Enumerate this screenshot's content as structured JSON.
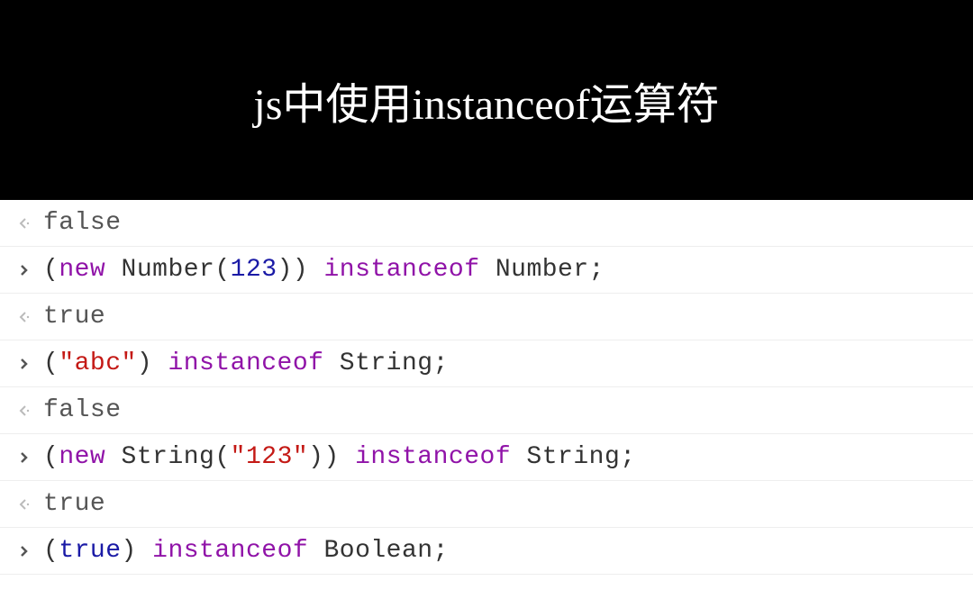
{
  "header": {
    "title": "js中使用instanceof运算符"
  },
  "console": {
    "rows": [
      {
        "type": "output",
        "tokens": [
          {
            "text": "false",
            "cls": "tok-result"
          }
        ]
      },
      {
        "type": "input",
        "tokens": [
          {
            "text": "(",
            "cls": "tok-default"
          },
          {
            "text": "new",
            "cls": "tok-keyword"
          },
          {
            "text": " Number(",
            "cls": "tok-default"
          },
          {
            "text": "123",
            "cls": "tok-number"
          },
          {
            "text": ")) ",
            "cls": "tok-default"
          },
          {
            "text": "instanceof",
            "cls": "tok-keyword"
          },
          {
            "text": " Number;",
            "cls": "tok-default"
          }
        ]
      },
      {
        "type": "output",
        "tokens": [
          {
            "text": "true",
            "cls": "tok-result"
          }
        ]
      },
      {
        "type": "input",
        "tokens": [
          {
            "text": "(",
            "cls": "tok-default"
          },
          {
            "text": "\"abc\"",
            "cls": "tok-string"
          },
          {
            "text": ") ",
            "cls": "tok-default"
          },
          {
            "text": "instanceof",
            "cls": "tok-keyword"
          },
          {
            "text": " String;",
            "cls": "tok-default"
          }
        ]
      },
      {
        "type": "output",
        "tokens": [
          {
            "text": "false",
            "cls": "tok-result"
          }
        ]
      },
      {
        "type": "input",
        "tokens": [
          {
            "text": "(",
            "cls": "tok-default"
          },
          {
            "text": "new",
            "cls": "tok-keyword"
          },
          {
            "text": " String(",
            "cls": "tok-default"
          },
          {
            "text": "\"123\"",
            "cls": "tok-string"
          },
          {
            "text": ")) ",
            "cls": "tok-default"
          },
          {
            "text": "instanceof",
            "cls": "tok-keyword"
          },
          {
            "text": " String;",
            "cls": "tok-default"
          }
        ]
      },
      {
        "type": "output",
        "tokens": [
          {
            "text": "true",
            "cls": "tok-result"
          }
        ]
      },
      {
        "type": "input",
        "tokens": [
          {
            "text": "(",
            "cls": "tok-default"
          },
          {
            "text": "true",
            "cls": "tok-bool"
          },
          {
            "text": ") ",
            "cls": "tok-default"
          },
          {
            "text": "instanceof",
            "cls": "tok-keyword"
          },
          {
            "text": " Boolean;",
            "cls": "tok-default"
          }
        ]
      }
    ]
  }
}
